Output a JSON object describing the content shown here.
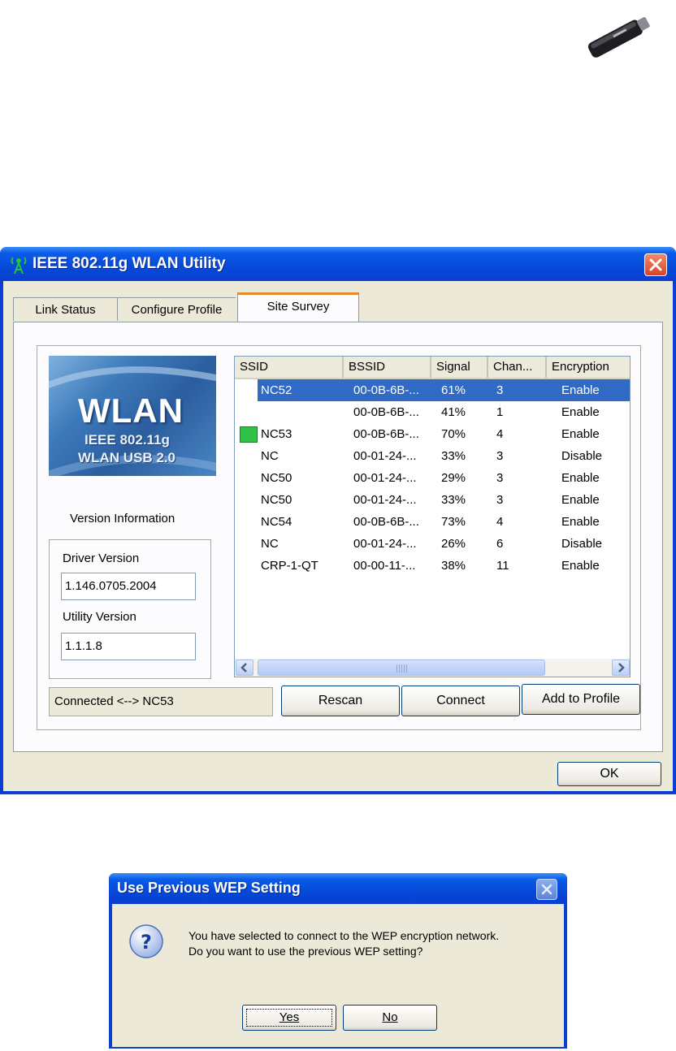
{
  "window": {
    "title": "IEEE 802.11g WLAN Utility",
    "tabs": [
      "Link Status",
      "Configure Profile",
      "Site Survey"
    ],
    "active_tab": "Site Survey",
    "logo": {
      "main": "WLAN",
      "line1": "IEEE 802.11g",
      "line2": "WLAN USB 2.0"
    },
    "version": {
      "section_label": "Version Information",
      "driver_label": "Driver Version",
      "driver_value": "1.146.0705.2004",
      "utility_label": "Utility Version",
      "utility_value": "1.1.1.8"
    },
    "columns": [
      "SSID",
      "BSSID",
      "Signal",
      "Chan...",
      "Encryption"
    ],
    "networks": [
      {
        "ssid": "NC52",
        "bssid": "00-0B-6B-...",
        "signal": "61%",
        "channel": "3",
        "encryption": "Enable"
      },
      {
        "ssid": "",
        "bssid": "00-0B-6B-...",
        "signal": "41%",
        "channel": "1",
        "encryption": "Enable"
      },
      {
        "ssid": "NC53",
        "bssid": "00-0B-6B-...",
        "signal": "70%",
        "channel": "4",
        "encryption": "Enable"
      },
      {
        "ssid": "NC",
        "bssid": "00-01-24-...",
        "signal": "33%",
        "channel": "3",
        "encryption": "Disable"
      },
      {
        "ssid": "NC50",
        "bssid": "00-01-24-...",
        "signal": "29%",
        "channel": "3",
        "encryption": "Enable"
      },
      {
        "ssid": "NC50",
        "bssid": "00-01-24-...",
        "signal": "33%",
        "channel": "3",
        "encryption": "Enable"
      },
      {
        "ssid": "NC54",
        "bssid": "00-0B-6B-...",
        "signal": "73%",
        "channel": "4",
        "encryption": "Enable"
      },
      {
        "ssid": "NC",
        "bssid": "00-01-24-...",
        "signal": "26%",
        "channel": "6",
        "encryption": "Disable"
      },
      {
        "ssid": "CRP-1-QT",
        "bssid": "00-00-11-...",
        "signal": "38%",
        "channel": "11",
        "encryption": "Enable"
      }
    ],
    "selected_row": 0,
    "connected_row": 2,
    "status": "Connected <--> NC53",
    "buttons": {
      "rescan": "Rescan",
      "connect": "Connect",
      "add_profile": "Add to Profile",
      "ok": "OK"
    }
  },
  "dialog": {
    "title": "Use Previous WEP Setting",
    "line1": "You have selected to connect to the WEP encryption network.",
    "line2": "Do you want to use the previous WEP setting?",
    "yes": "Yes",
    "no": "No"
  },
  "colors": {
    "titlebar": "#0a53e0",
    "selection": "#316ac5",
    "face": "#ece9d8",
    "active_tab_accent": "#e68b2c"
  }
}
